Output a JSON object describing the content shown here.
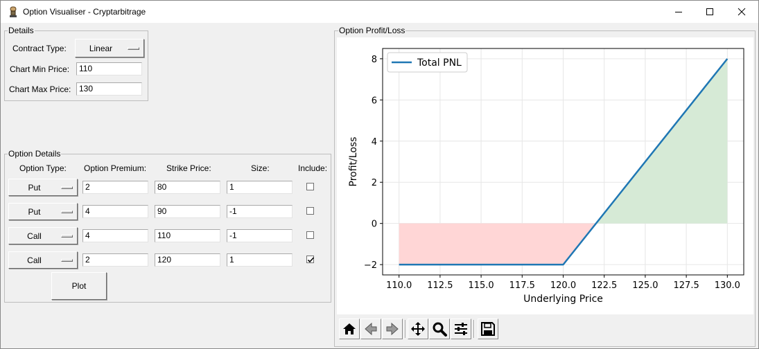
{
  "window": {
    "title": "Option Visualiser - Cryptarbitrage"
  },
  "details": {
    "legend": "Details",
    "contract_type_label": "Contract Type:",
    "contract_type_value": "Linear",
    "chart_min_label": "Chart Min Price:",
    "chart_min_value": "110",
    "chart_max_label": "Chart Max Price:",
    "chart_max_value": "130"
  },
  "option_details": {
    "legend": "Option Details",
    "headers": {
      "type": "Option Type:",
      "premium": "Option Premium:",
      "strike": "Strike Price:",
      "size": "Size:",
      "include": "Include:"
    },
    "rows": [
      {
        "type": "Put",
        "premium": "2",
        "strike": "80",
        "size": "1",
        "include": false
      },
      {
        "type": "Put",
        "premium": "4",
        "strike": "90",
        "size": "-1",
        "include": false
      },
      {
        "type": "Call",
        "premium": "4",
        "strike": "110",
        "size": "-1",
        "include": false
      },
      {
        "type": "Call",
        "premium": "2",
        "strike": "120",
        "size": "1",
        "include": true
      }
    ],
    "plot_button": "Plot"
  },
  "chart_panel": {
    "legend": "Option Profit/Loss"
  },
  "chart_data": {
    "type": "line",
    "xlabel": "Underlying Price",
    "ylabel": "Profit/Loss",
    "xlim": [
      109.0,
      131.0
    ],
    "ylim": [
      -2.5,
      8.5
    ],
    "xticks": [
      110.0,
      112.5,
      115.0,
      117.5,
      120.0,
      122.5,
      125.0,
      127.5,
      130.0
    ],
    "xtick_labels": [
      "110.0",
      "112.5",
      "115.0",
      "117.5",
      "120.0",
      "122.5",
      "125.0",
      "127.5",
      "130.0"
    ],
    "yticks": [
      -2,
      0,
      2,
      4,
      6,
      8
    ],
    "ytick_labels": [
      "−2",
      "0",
      "2",
      "4",
      "6",
      "8"
    ],
    "grid": true,
    "legend_position": "top-left",
    "series": [
      {
        "name": "Total PNL",
        "x": [
          110,
          120,
          130
        ],
        "y": [
          -2,
          -2,
          8
        ],
        "color": "#1f77b4"
      }
    ],
    "fill_loss_color": "#ffd6d6",
    "fill_profit_color": "#d6ead6"
  },
  "toolbar": {
    "home": "home-icon",
    "back": "back-arrow-icon",
    "forward": "forward-arrow-icon",
    "pan": "move-arrows-icon",
    "zoom": "magnifier-icon",
    "configure": "sliders-icon",
    "save": "floppy-disk-icon"
  }
}
